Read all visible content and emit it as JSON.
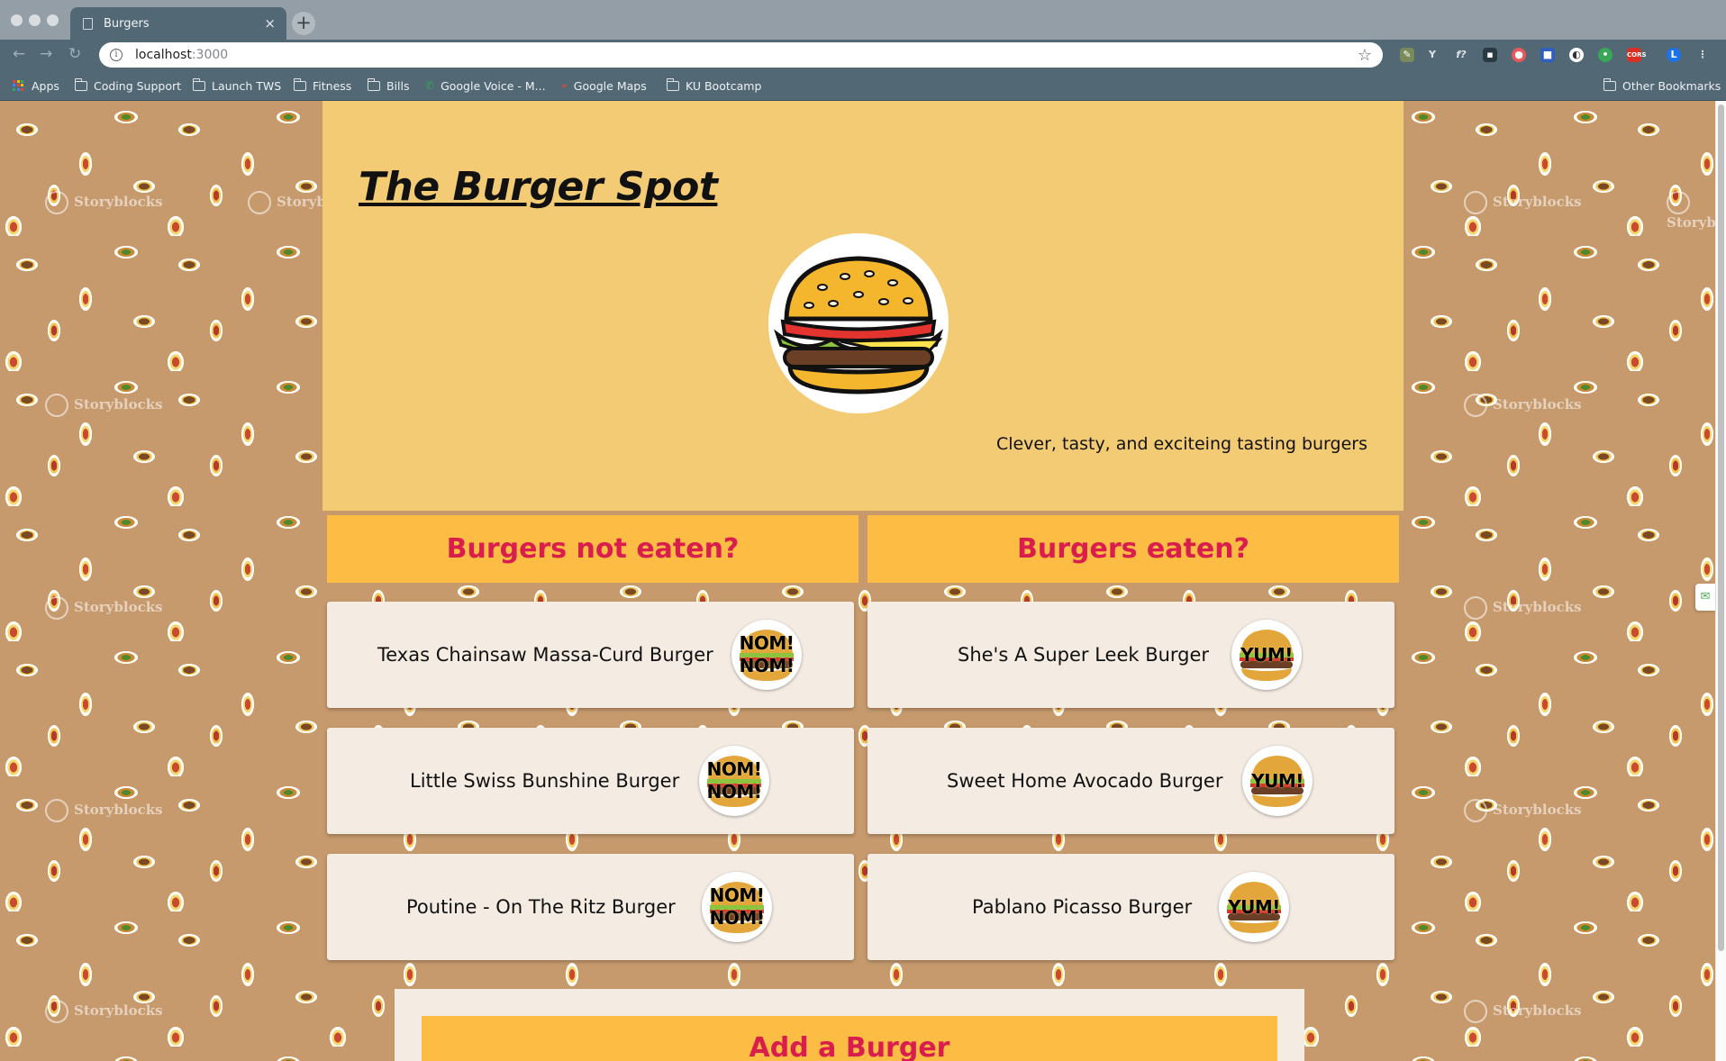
{
  "browser": {
    "tab_title": "Burgers",
    "tab_close": "×",
    "new_tab": "+",
    "url_host": "localhost",
    "url_port": ":3000",
    "star": "☆",
    "bookmarks": [
      {
        "label": "Apps",
        "icon": "apps-grid-icon"
      },
      {
        "label": "Coding Support",
        "icon": "folder-icon"
      },
      {
        "label": "Launch TWS",
        "icon": "folder-icon"
      },
      {
        "label": "Fitness",
        "icon": "folder-icon"
      },
      {
        "label": "Bills",
        "icon": "folder-icon"
      },
      {
        "label": "Google Voice - M...",
        "icon": "phone-icon"
      },
      {
        "label": "Google Maps",
        "icon": "maps-icon"
      },
      {
        "label": "KU Bootcamp",
        "icon": "folder-icon"
      }
    ],
    "other_bookmarks": "Other Bookmarks",
    "extensions": [
      "pen-icon",
      "y-icon",
      "f-icon",
      "grid-icon",
      "record-icon",
      "square-icon",
      "circle-icon",
      "chat-icon",
      "cors-icon"
    ],
    "profile_initial": "L"
  },
  "background": {
    "watermark": "Storyblocks"
  },
  "hero": {
    "title": "The Burger Spot",
    "tagline": "Clever, tasty, and exciteing tasting burgers"
  },
  "columns": {
    "not_eaten_heading": "Burgers not eaten?",
    "eaten_heading": "Burgers eaten?"
  },
  "burgers_not_eaten": [
    {
      "name": "Texas Chainsaw Massa-Curd Burger",
      "button": "NOM! NOM!"
    },
    {
      "name": "Little Swiss Bunshine Burger",
      "button": "NOM! NOM!"
    },
    {
      "name": "Poutine - On The Ritz Burger",
      "button": "NOM! NOM!"
    }
  ],
  "burgers_eaten": [
    {
      "name": "She's A Super Leek Burger",
      "button": "YUM!"
    },
    {
      "name": "Sweet Home Avocado Burger",
      "button": "YUM!"
    },
    {
      "name": "Pablano Picasso Burger",
      "button": "YUM!"
    }
  ],
  "form": {
    "heading": "Add a Burger"
  },
  "colors": {
    "hero_bg": "#f3cb74",
    "heading_bg": "#fdbd44",
    "heading_text": "#d91d4d",
    "card_bg": "#f4ece3",
    "page_bg": "#c69a6d",
    "chrome_dark": "#526975"
  }
}
